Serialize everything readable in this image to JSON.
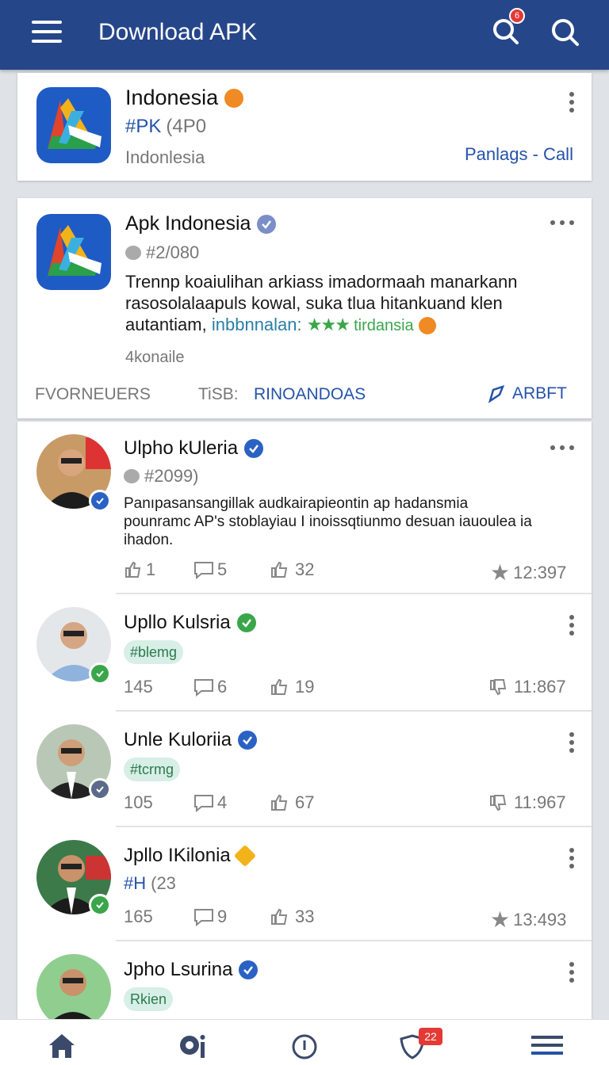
{
  "header": {
    "title": "Download APK",
    "notif_count": "6"
  },
  "card1": {
    "title": "Indonesia",
    "hashtag": "#PK",
    "meta": "(4P0",
    "subtitle": "Indonlesia",
    "link": "Panlags - Call"
  },
  "card2": {
    "title": "Apk Indonesia",
    "comment_meta": "#2/080",
    "text_line1": "Trennp koaiulihan arkiass imadormaah manarkann",
    "text_line2": "rasosolalaapuls kowal, suka tlua hitankuand klen",
    "text_line3_start": "autantiam,",
    "text_link": "inbbnnalan:",
    "text_tag": "tirdansia",
    "footer_note": "4konaile",
    "tab1": "FVORNEUERS",
    "tab2": "TiSB:",
    "tab3": "RINOANDOAS",
    "action": "ARBFT"
  },
  "posts": [
    {
      "name": "Ulpho kUleria",
      "meta": "#2099)",
      "text_line1": "Panıpasansangillak audkairapieontin ap hadansmia",
      "text_line2": "pounramc AP's stoblayiau I inoissqtiunmo desuan iauoulea ia",
      "text_line3": "ihadon.",
      "likes": "1",
      "comments": "5",
      "shares": "32",
      "time": "12:397"
    },
    {
      "name": "Upllo Kulsria",
      "tag": "#blemg",
      "views": "145",
      "comments": "6",
      "shares": "19",
      "time": "11:867"
    },
    {
      "name": "Unle Kuloriia",
      "tag": "#tcrmg",
      "views": "105",
      "comments": "4",
      "shares": "67",
      "time": "11:967"
    },
    {
      "name": "Jpllo IKilonia",
      "hashtag": "#H",
      "meta": "(23",
      "views": "165",
      "comments": "9",
      "shares": "33",
      "time": "13:493"
    },
    {
      "name": "Jpho Lsurina",
      "tag": "Rkien"
    }
  ],
  "bottom_nav": {
    "badge": "22"
  },
  "colors": {
    "brand": "#26468a",
    "link": "#2553a8",
    "verified_blue": "#2a62c4",
    "verified_green": "#3aa64a",
    "star_green": "#3aa64a"
  }
}
